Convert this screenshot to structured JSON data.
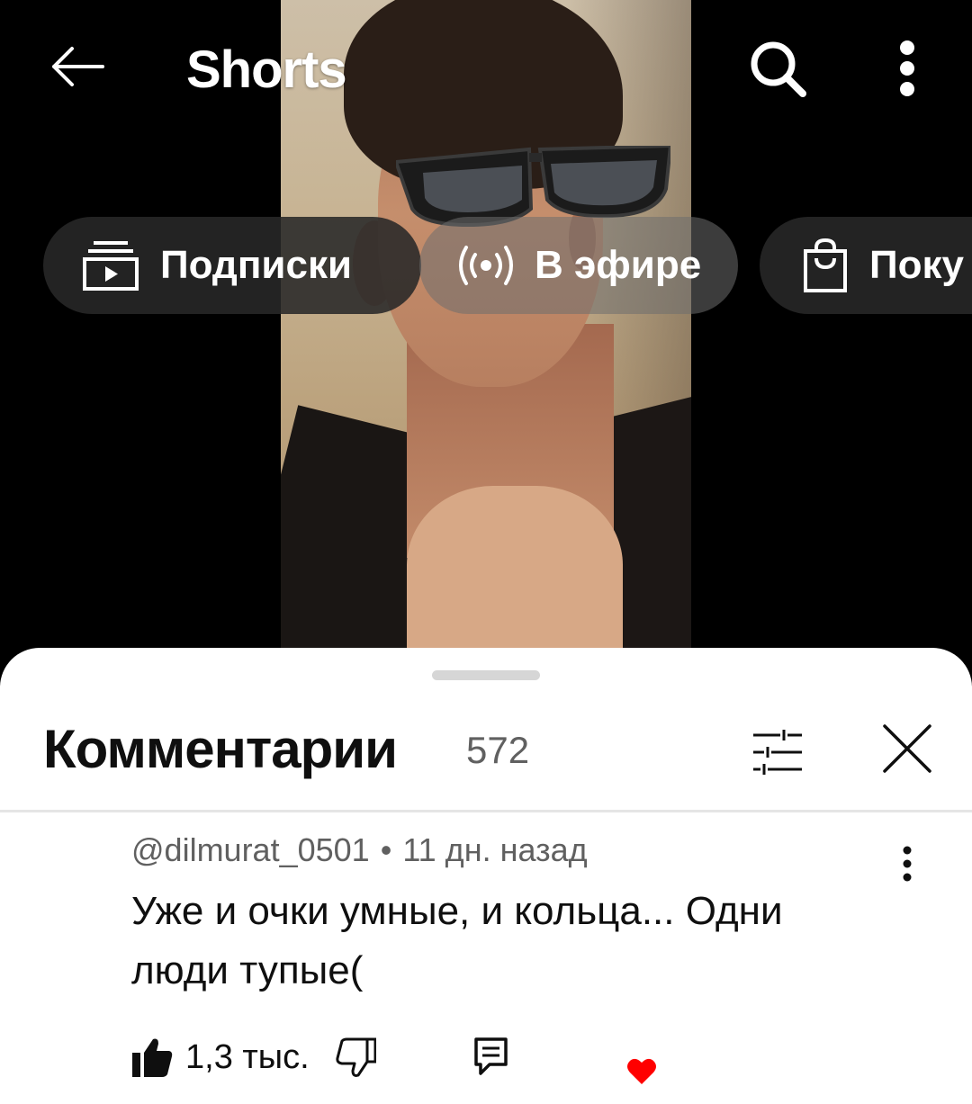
{
  "topbar": {
    "title": "Shorts"
  },
  "chips": [
    {
      "label": "Подписки",
      "icon": "subscriptions-icon"
    },
    {
      "label": "В эфире",
      "icon": "live-icon"
    },
    {
      "label": "Поку",
      "icon": "shopping-bag-icon"
    }
  ],
  "comments_panel": {
    "title": "Комментарии",
    "count": "572",
    "comment": {
      "author": "@dilmurat_0501",
      "separator": "•",
      "time": "11 дн. назад",
      "text": "Уже и очки умные, и кольца... Одни люди тупые(",
      "likes": "1,3 тыс.",
      "creator_heart": true
    }
  },
  "colors": {
    "background": "#000000",
    "sheet": "#ffffff",
    "chip": "#282828",
    "meta_text": "#606060",
    "heart": "#ff0000"
  }
}
